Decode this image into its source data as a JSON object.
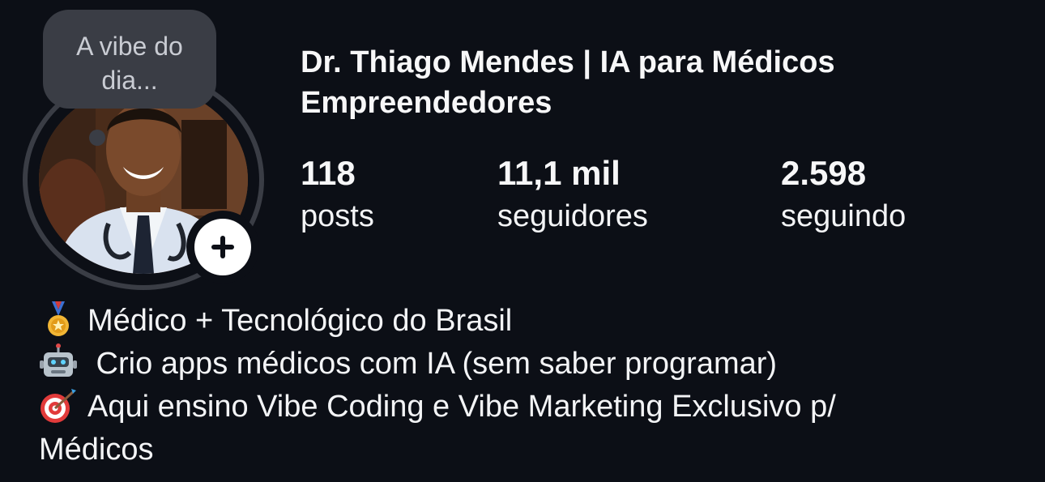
{
  "profile": {
    "name": "Dr. Thiago Mendes | IA para Médicos Empreendedores",
    "note": "A vibe do dia...",
    "avatar_icon": "doctor-portrait",
    "add_story_icon": "plus-icon"
  },
  "stats": {
    "posts": {
      "value": "118",
      "label": "posts"
    },
    "followers": {
      "value": "11,1 mil",
      "label": "seguidores"
    },
    "following": {
      "value": "2.598",
      "label": "seguindo"
    }
  },
  "bio": {
    "lines": [
      {
        "icon": "medal-icon",
        "text": "Médico + Tecnológico do Brasil"
      },
      {
        "icon": "robot-icon",
        "text": " Crio apps médicos com IA (sem saber programar)"
      },
      {
        "icon": "target-icon",
        "text": "Aqui ensino Vibe Coding e Vibe Marketing Exclusivo p/"
      },
      {
        "icon": "",
        "text": "Médicos"
      }
    ]
  },
  "colors": {
    "background": "#0c0f16",
    "text": "#f3f4f6",
    "ring": "#3a3d45",
    "note_bubble": "#3a3d45"
  }
}
